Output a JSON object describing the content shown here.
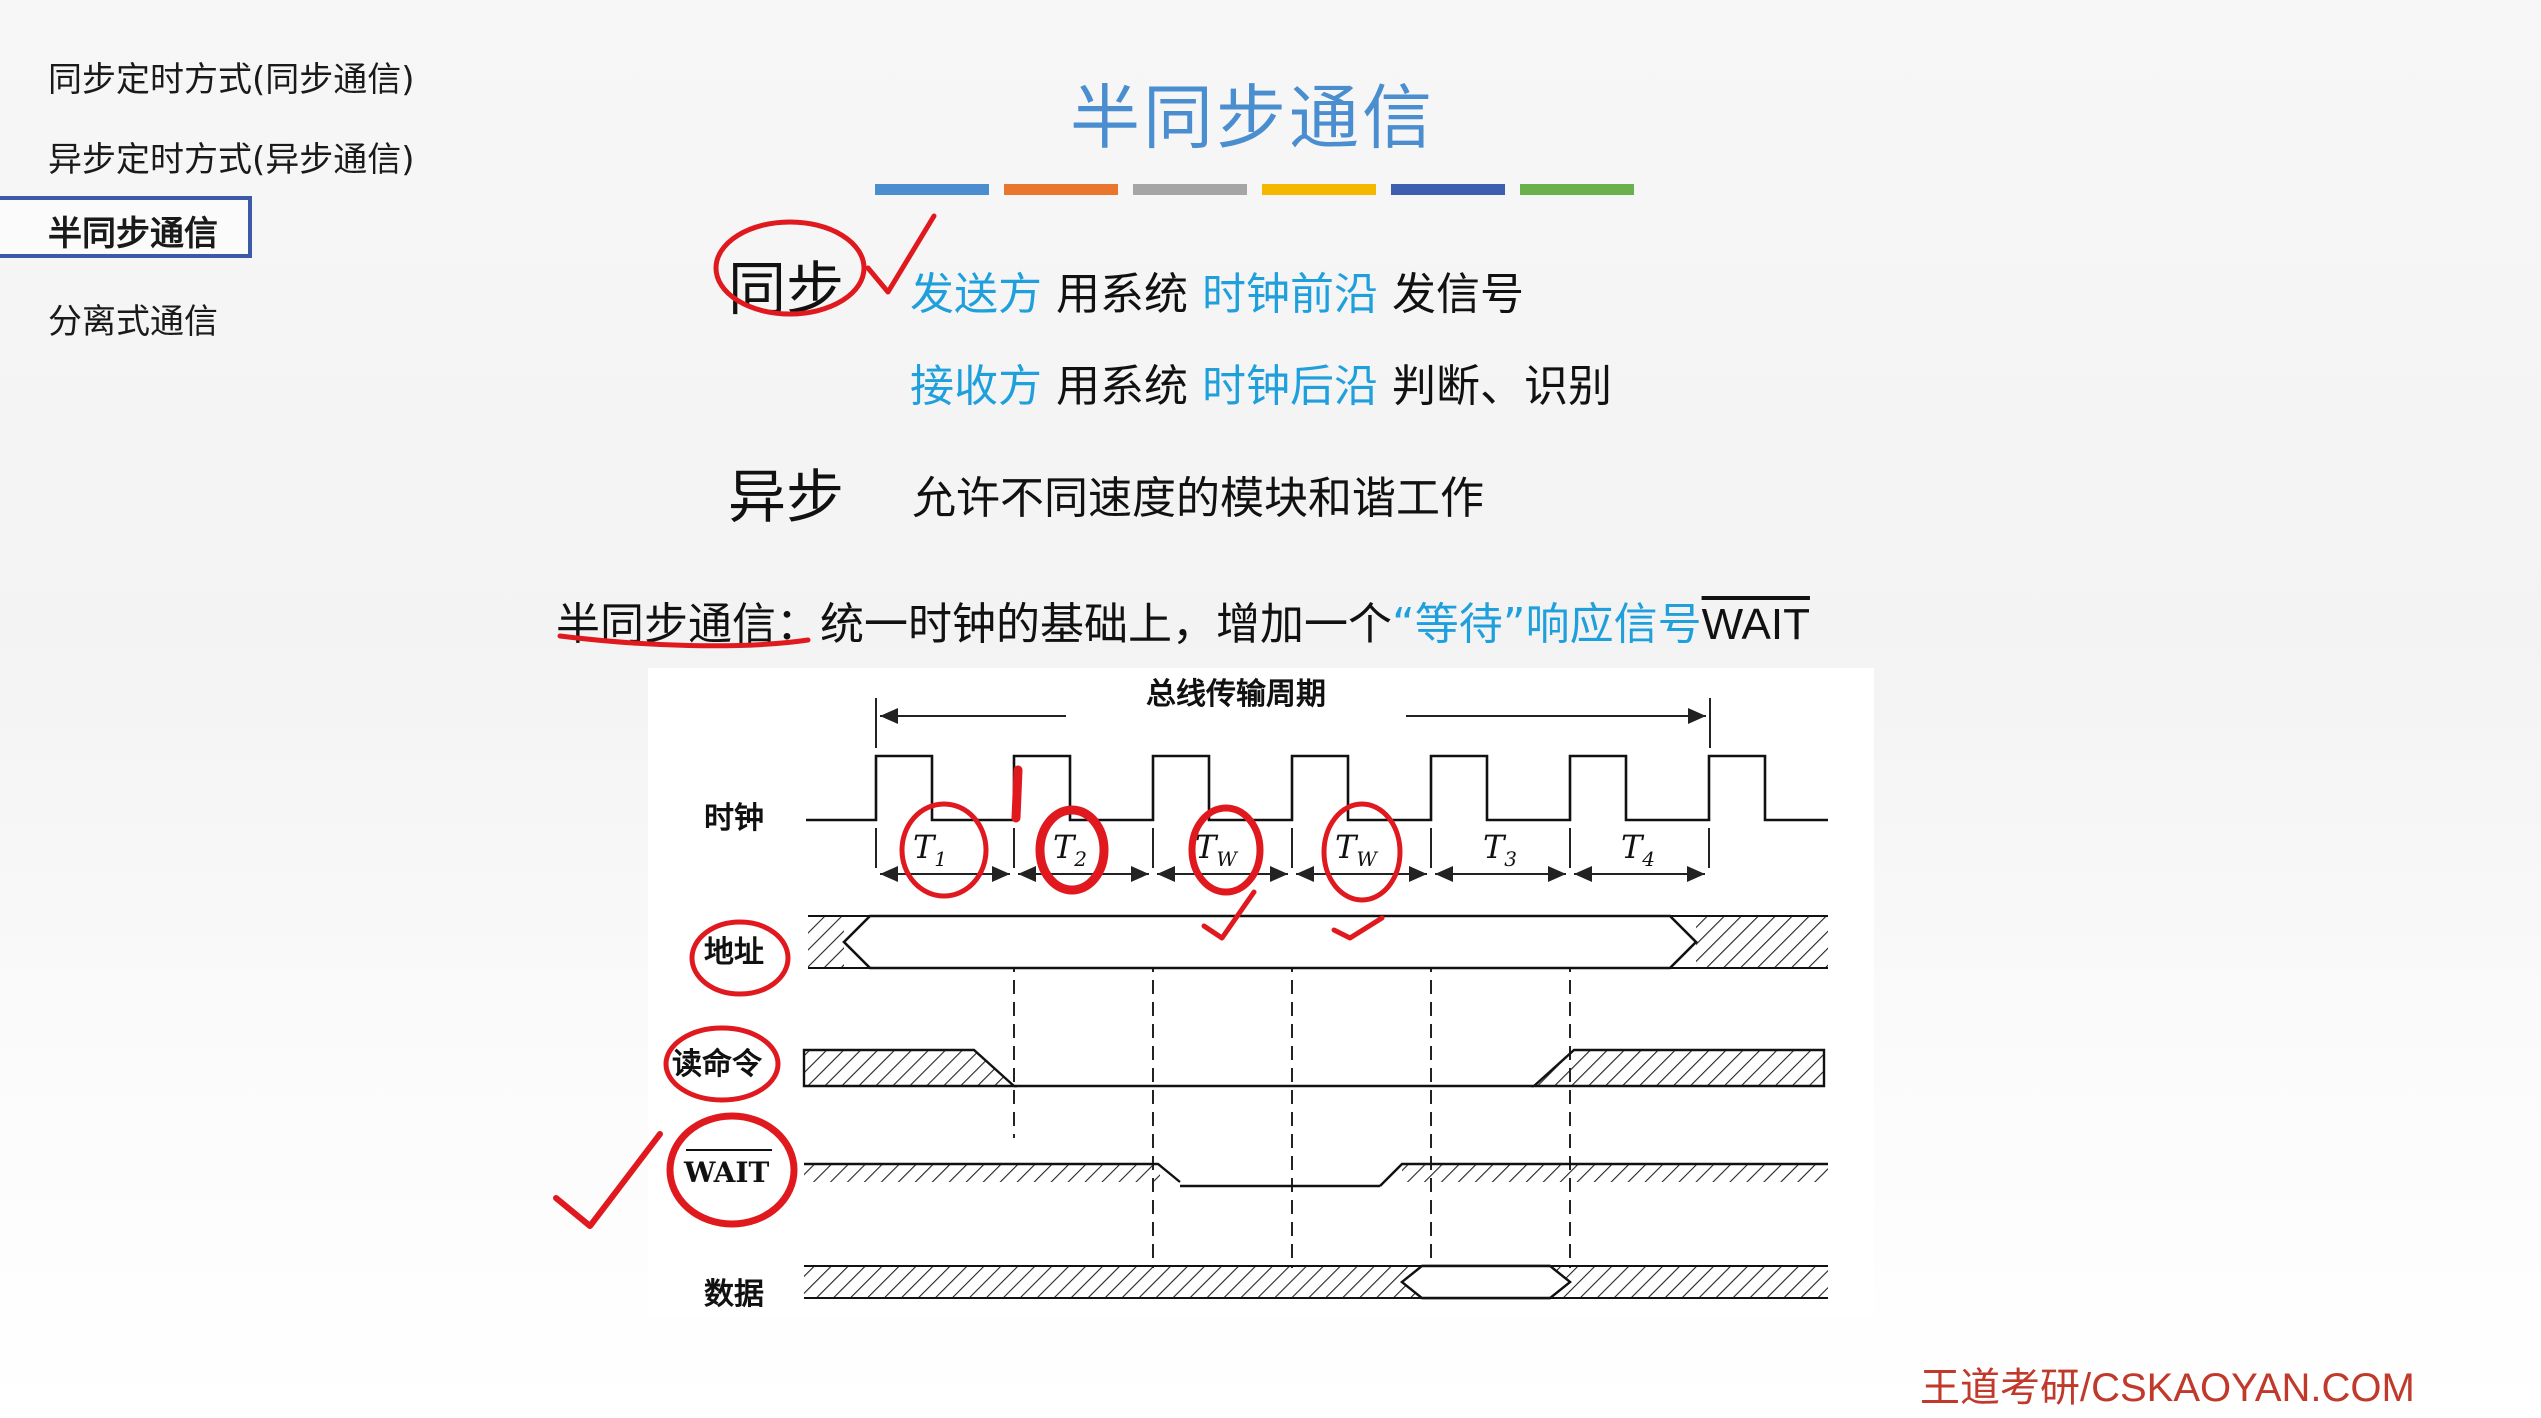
{
  "sidebar": {
    "items": [
      {
        "label": "同步定时方式(同步通信)"
      },
      {
        "label": "异步定时方式(异步通信)"
      },
      {
        "label": "半同步通信"
      },
      {
        "label": "分离式通信"
      }
    ]
  },
  "title": "半同步通信",
  "colors": {
    "title": "#4a8ed0",
    "accent_text": "#1fa0dc",
    "annotation_red": "#e0191f",
    "active_border": "#3d5aa8",
    "color_bars": [
      "#4a8ed0",
      "#e8762d",
      "#a5a5a5",
      "#f5b800",
      "#3e5eb0",
      "#6ab04c"
    ]
  },
  "sync": {
    "label": "同步",
    "row1": {
      "part1": "发送方",
      "part2": "用系统",
      "part3": "时钟前沿",
      "part4": "发信号"
    },
    "row2": {
      "part1": "接收方",
      "part2": "用系统",
      "part3": "时钟后沿",
      "part4": "判断、识别"
    }
  },
  "async": {
    "label": "异步",
    "text": "允许不同速度的模块和谐工作"
  },
  "semi": {
    "label": "半同步通信",
    "colon": "：统一时钟的基础上，增加一个",
    "quote": "“等待”响应信号",
    "signal": "WAIT"
  },
  "diagram": {
    "period_label": "总线传输周期",
    "rows": {
      "clock": "时钟",
      "address": "地址",
      "read": "读命令",
      "wait": "WAIT",
      "data": "数据"
    },
    "states": [
      {
        "main": "T",
        "sub": "1"
      },
      {
        "main": "T",
        "sub": "2"
      },
      {
        "main": "T",
        "sub": "W"
      },
      {
        "main": "T",
        "sub": "W"
      },
      {
        "main": "T",
        "sub": "3"
      },
      {
        "main": "T",
        "sub": "4"
      }
    ]
  },
  "watermark": "王道考研/CSKAOYAN.COM"
}
